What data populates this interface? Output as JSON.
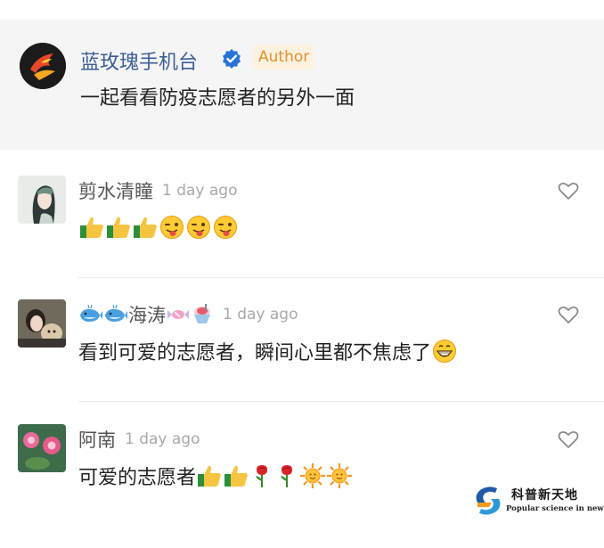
{
  "post": {
    "author_name": "蓝玫瑰手机台",
    "author_badge": "Author",
    "text": "一起看看防疫志愿者的另外一面"
  },
  "comments": [
    {
      "name": "剪水清瞳",
      "time": "1 day ago",
      "text": "",
      "emojis": [
        "thumbs-up",
        "thumbs-up",
        "thumbs-up",
        "winking-tongue-face",
        "winking-tongue-face",
        "winking-tongue-face"
      ]
    },
    {
      "name_prefix_emojis": [
        "whale",
        "whale"
      ],
      "name": "海涛",
      "name_suffix_emojis": [
        "candy",
        "shaved-ice"
      ],
      "time": "1 day ago",
      "text": "看到可爱的志愿者，瞬间心里都不焦虑了",
      "emojis": [
        "grinning-face"
      ]
    },
    {
      "name": "阿南",
      "time": "1 day ago",
      "text": "可爱的志愿者",
      "emojis": [
        "thumbs-up",
        "thumbs-up",
        "rose",
        "rose",
        "sun",
        "sun"
      ]
    }
  ],
  "watermark": {
    "title": "科普新天地",
    "subtitle": "Popular science in new world"
  },
  "colors": {
    "author_name": "#3c5f98",
    "verified": "#2a73d6",
    "author_badge_text": "#e2922b",
    "author_badge_bg": "#fdf1e0",
    "comment_name": "#555555",
    "timestamp": "#a8a8a8"
  }
}
